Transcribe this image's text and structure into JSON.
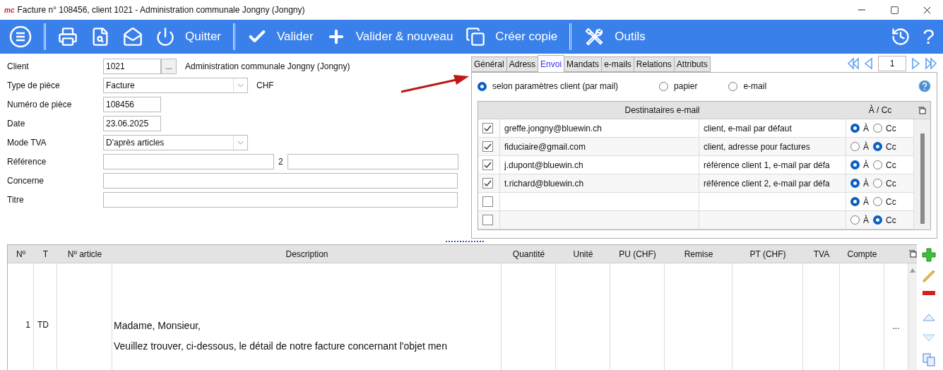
{
  "window": {
    "logo": "mc",
    "title": "Facture n° 108456, client 1021 - Administration communale Jongny (Jongny)"
  },
  "toolbar": {
    "items": [
      {
        "kind": "menu"
      },
      {
        "kind": "separator"
      },
      {
        "kind": "print"
      },
      {
        "kind": "preview"
      },
      {
        "kind": "mail"
      },
      {
        "kind": "power",
        "label": "Quitter"
      },
      {
        "kind": "separator"
      },
      {
        "kind": "check",
        "label": "Valider"
      },
      {
        "kind": "plus",
        "label": "Valider & nouveau"
      },
      {
        "kind": "copy",
        "label": "Créer copie"
      },
      {
        "kind": "separator"
      },
      {
        "kind": "tools",
        "label": "Outils"
      }
    ],
    "right": [
      {
        "kind": "history"
      },
      {
        "kind": "help",
        "label": "?"
      }
    ]
  },
  "form": [
    {
      "kind": "lookup",
      "label": "Client",
      "value": "1021",
      "button": "...",
      "note": "Administration communale Jongny (Jongny)"
    },
    {
      "kind": "select",
      "label": "Type de pièce",
      "value": "Facture",
      "note": "CHF"
    },
    {
      "kind": "short",
      "label": "Numéro de pièce",
      "value": "108456"
    },
    {
      "kind": "short",
      "label": "Date",
      "value": "23.06.2025"
    },
    {
      "kind": "select",
      "label": "Mode TVA",
      "value": "D'après articles"
    },
    {
      "kind": "pair",
      "label": "Référence",
      "separator": "2"
    },
    {
      "kind": "wide",
      "label": "Concerne"
    },
    {
      "kind": "wide",
      "label": "Titre"
    }
  ],
  "tabs": [
    {
      "label": "Général",
      "selected": false
    },
    {
      "label": "Adress",
      "selected": false
    },
    {
      "label": "Envoi",
      "selected": true
    },
    {
      "label": "Mandats",
      "selected": false
    },
    {
      "label": "e-mails",
      "selected": false
    },
    {
      "label": "Relations",
      "selected": false
    },
    {
      "label": "Attributs",
      "selected": false
    }
  ],
  "pager": {
    "value": "1"
  },
  "send_options": [
    {
      "label": "selon paramètres client (par mail)",
      "selected": true
    },
    {
      "label": "papier",
      "selected": false
    },
    {
      "label": "e-mail",
      "selected": false
    }
  ],
  "recipients": {
    "columns": [
      "Destinataires e-mail",
      "À / Cc"
    ],
    "rows": [
      {
        "checked": true,
        "email": "greffe.jongny@bluewin.ch",
        "source": "client, e-mail par défaut",
        "options": [
          {
            "label": "À",
            "selected": true
          },
          {
            "label": "Cc",
            "selected": false
          }
        ]
      },
      {
        "checked": true,
        "email": "fiduciaire@gmail.com",
        "source": "client, adresse pour factures",
        "options": [
          {
            "label": "À",
            "selected": false
          },
          {
            "label": "Cc",
            "selected": true
          }
        ]
      },
      {
        "checked": true,
        "email": "j.dupont@bluewin.ch",
        "source": "référence client 1, e-mail par défa",
        "options": [
          {
            "label": "À",
            "selected": true
          },
          {
            "label": "Cc",
            "selected": false
          }
        ]
      },
      {
        "checked": true,
        "email": "t.richard@bluewin.ch",
        "source": "référence client 2, e-mail par défa",
        "options": [
          {
            "label": "À",
            "selected": true
          },
          {
            "label": "Cc",
            "selected": false
          }
        ]
      },
      {
        "checked": false,
        "options": [
          {
            "label": "À",
            "selected": true
          },
          {
            "label": "Cc",
            "selected": false
          }
        ]
      },
      {
        "checked": false,
        "options": [
          {
            "label": "À",
            "selected": false
          },
          {
            "label": "Cc",
            "selected": true
          }
        ]
      }
    ]
  },
  "lines": {
    "columns": [
      "Nº",
      "T",
      "Nº article",
      "Description",
      "Quantité",
      "Unité",
      "PU (CHF)",
      "Remise",
      "PT (CHF)",
      "TVA",
      "Compte"
    ],
    "rows": [
      {
        "no": "1",
        "type": "TD",
        "description": [
          "Madame, Monsieur,",
          "Veuillez trouver, ci-dessous, le détail de notre facture concernant l'objet men"
        ],
        "more": "..."
      }
    ]
  },
  "line_actions": [
    {
      "kind": "add"
    },
    {
      "kind": "edit"
    },
    {
      "kind": "remove"
    },
    {
      "kind": "up"
    },
    {
      "kind": "down"
    },
    {
      "kind": "copy"
    }
  ]
}
